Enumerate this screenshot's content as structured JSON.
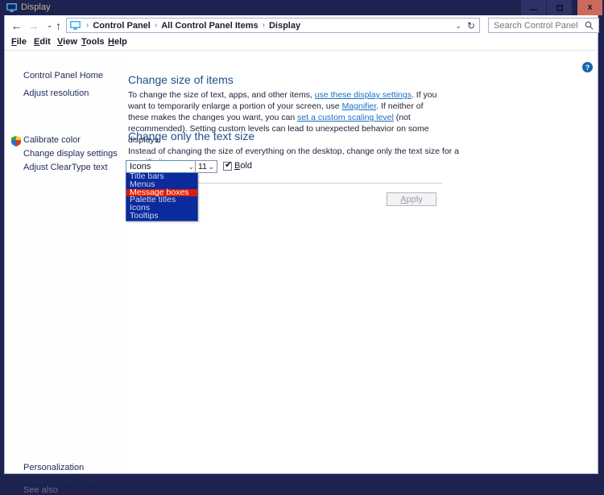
{
  "window": {
    "title": "Display",
    "icon": "monitor-icon",
    "controls": {
      "minimize": "–",
      "maximize": "□",
      "close": "x"
    }
  },
  "nav": {
    "back": "←",
    "forward": "→",
    "recent": "⌄",
    "up": "↑",
    "dropdown": "⌄",
    "refresh": "↻",
    "breadcrumbs": [
      "Control Panel",
      "All Control Panel Items",
      "Display"
    ],
    "separator": "›"
  },
  "search": {
    "placeholder": "Search Control Panel",
    "value": "",
    "icon": "search-icon"
  },
  "menubar": {
    "items": [
      "File",
      "Edit",
      "View",
      "Tools",
      "Help"
    ]
  },
  "sidebar": {
    "home": "Control Panel Home",
    "items": [
      {
        "label": "Adjust resolution",
        "icon": null
      },
      {
        "label": "Calibrate color",
        "icon": "shield-icon"
      },
      {
        "label": "Change display settings",
        "icon": null
      },
      {
        "label": "Adjust ClearType text",
        "icon": null
      }
    ],
    "see_also_label": "See also",
    "see_also": [
      "Personalization",
      "Devices and Printers"
    ]
  },
  "main": {
    "section1": {
      "title": "Change size of items",
      "text_before_1": "To change the size of text, apps, and other items, ",
      "link1": "use these display settings",
      "text_mid_1": ".  If you want to temporarily enlarge a portion of your screen, use ",
      "link2": "Magnifier",
      "text_mid_2": ".  If neither of these makes the changes you want, you can ",
      "link3": "set a custom scaling level",
      "text_after": " (not recommended).  Setting custom levels can lead to unexpected behavior on some displays."
    },
    "section2": {
      "title": "Change only the text size",
      "description": "Instead of changing the size of everything on the desktop, change only the text size for a specific item."
    },
    "item_combo": {
      "selected": "Icons",
      "arrow": "⌄",
      "open": true,
      "options": [
        {
          "label": "Title bars",
          "highlighted": false
        },
        {
          "label": "Menus",
          "highlighted": false
        },
        {
          "label": "Message boxes",
          "highlighted": true
        },
        {
          "label": "Palette titles",
          "highlighted": false
        },
        {
          "label": "Icons",
          "highlighted": false
        },
        {
          "label": "Tooltips",
          "highlighted": false
        }
      ]
    },
    "size_combo": {
      "selected": "11",
      "arrow": "⌄"
    },
    "bold": {
      "label": "Bold",
      "accel": "B",
      "checked": true,
      "tick": "✔"
    },
    "apply_button": {
      "label": "pply",
      "accel": "A",
      "disabled": true
    }
  },
  "help": {
    "icon": "help-question-icon",
    "glyph": "?"
  },
  "colors": {
    "window_chrome": "#1d2251",
    "close_button": "#cc6a5e",
    "title_text": "#c8b58a",
    "heading": "#1a4f8a",
    "link": "#1a6fc4",
    "dropdown_bg": "#0b2a9b",
    "dropdown_highlight": "#e01b00",
    "dropdown_text": "#cfd8f0"
  }
}
